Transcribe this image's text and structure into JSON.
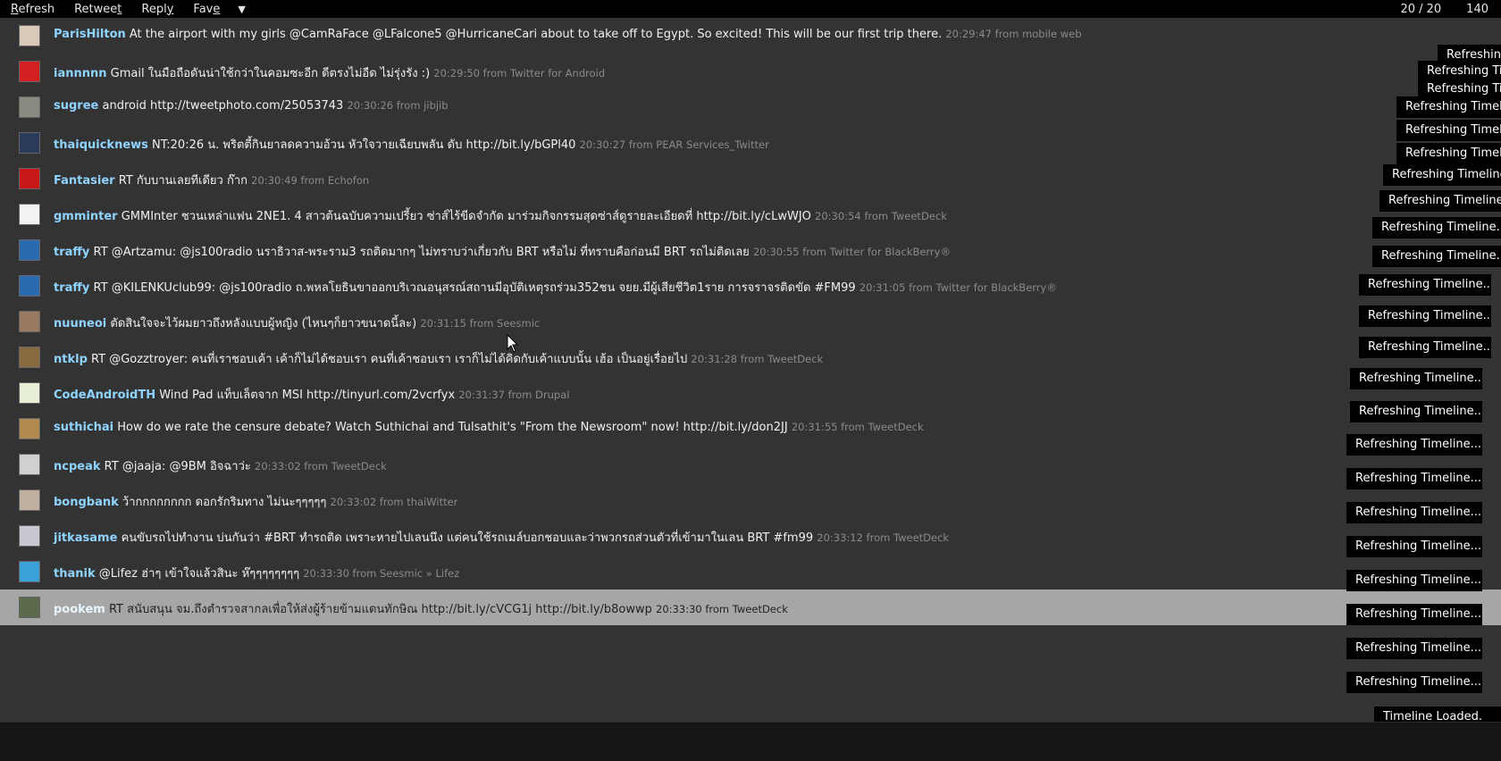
{
  "toolbar": {
    "refresh": {
      "pre": "",
      "key": "R",
      "post": "efresh"
    },
    "retweet": {
      "pre": "Retwee",
      "key": "t",
      "post": ""
    },
    "reply": {
      "pre": "Repl",
      "key": "y",
      "post": ""
    },
    "fave": {
      "pre": "Fav",
      "key": "e",
      "post": ""
    },
    "menu_arrow": "▼",
    "count": "20 / 20",
    "chars_left": "140"
  },
  "tweets": [
    {
      "user": "ParisHilton",
      "text": "At the airport with my girls @CamRaFace @LFalcone5 @HurricaneCari about to take off to Egypt. So excited! This will be our first trip there.",
      "meta": "20:29:47 from mobile web",
      "avatar_color": "#d9c9b8"
    },
    {
      "user": "iannnnn",
      "text": "Gmail ในมือถือดันน่าใช้กว่าในคอมซะอีก ดีตรงไม่อืด ไม่รุ่งรัง :)",
      "meta": "20:29:50 from Twitter for Android",
      "avatar_color": "#d42020"
    },
    {
      "user": "sugree",
      "text": "android http://tweetphoto.com/25053743",
      "meta": "20:30:26 from jibjib",
      "avatar_color": "#8a8a80"
    },
    {
      "user": "thaiquicknews",
      "text": "NT:20:26 น. พริตตี้กินยาลดความอ้วน หัวใจวายเฉียบพลัน ดับ http://bit.ly/bGPl40",
      "meta": "20:30:27 from PEAR Services_Twitter",
      "avatar_color": "#2a3a5a"
    },
    {
      "user": "Fantasier",
      "text": "RT กับบานเลยทีเดียว ก๊าก",
      "meta": "20:30:49 from Echofon",
      "avatar_color": "#c81818"
    },
    {
      "user": "gmminter",
      "text": "GMMInter ชวนเหล่าแฟน 2NE1. 4 สาวต้นฉบับความเปรี้ยว ซ่าส์ไร้ขีดจำกัด มาร่วมกิจกรรมสุดซ่าส์ดูรายละเอียดที่ http://bit.ly/cLwWJO",
      "meta": "20:30:54 from TweetDeck",
      "avatar_color": "#f2f2f2"
    },
    {
      "user": "traffy",
      "text": "RT @Artzamu: @js100radio นราธิวาส-พระราม3 รถติดมากๆ ไม่ทราบว่าเกี่ยวกับ BRT หรือไม่ ที่ทราบคือก่อนมี BRT รถไม่ติดเลย",
      "meta": "20:30:55 from Twitter for BlackBerry®",
      "avatar_color": "#2a6ab0"
    },
    {
      "user": "traffy",
      "text": "RT @KILENKUclub99: @js100radio ถ.พหลโยธินขาออกบริเวณอนุสรณ์สถานมีอุบัติเหตุรถร่วม352ชน จยย.มีผู้เสียชีวิต1ราย การจราจรติดขัด #FM99",
      "meta": "20:31:05 from Twitter for BlackBerry®",
      "avatar_color": "#2a6ab0"
    },
    {
      "user": "nuuneoi",
      "text": "ตัดสินใจจะไว้ผมยาวถึงหลังแบบผู้หญิง (ไหนๆก็ยาวขนาดนี้ละ)",
      "meta": "20:31:15 from Seesmic",
      "avatar_color": "#9a7a60"
    },
    {
      "user": "ntklp",
      "text": "RT @Gozztroyer: คนที่เราชอบเค้า เค้าก็ไม่ได้ชอบเรา คนที่เค้าชอบเรา เราก็ไม่ได้คิดกับเค้าแบบนั้น เฮ้อ เป็นอยู่เรื่อยไป",
      "meta": "20:31:28 from TweetDeck",
      "avatar_color": "#8a6a40"
    },
    {
      "user": "CodeAndroidTH",
      "text": "Wind Pad แท็บเล็ตจาก MSI http://tinyurl.com/2vcrfyx",
      "meta": "20:31:37 from Drupal",
      "avatar_color": "#e8f0d8"
    },
    {
      "user": "suthichai",
      "text": "How do we rate the censure debate? Watch Suthichai and Tulsathit's \"From the Newsroom\" now! http://bit.ly/don2JJ",
      "meta": "20:31:55 from TweetDeck",
      "avatar_color": "#b08a50"
    },
    {
      "user": "ncpeak",
      "text": "RT @jaaja: @9BM อิจฉาว่ะ",
      "meta": "20:33:02 from TweetDeck",
      "avatar_color": "#d0d0d0"
    },
    {
      "user": "bongbank",
      "text": "ว้ากกกกกกกก ดอกรักริมทาง ไม่นะๆๆๆๆๆ",
      "meta": "20:33:02 from thaiWitter",
      "avatar_color": "#c0b0a0"
    },
    {
      "user": "jitkasame",
      "text": "คนขับรถไปทำงาน บ่นกันว่า #BRT ทำรถติด เพราะหายไปเลนนึง แต่คนใช้รถเมล์บอกชอบและว่าพวกรถส่วนตัวที่เข้ามาในเลน BRT #fm99",
      "meta": "20:33:12 from TweetDeck",
      "avatar_color": "#c8c8d0"
    },
    {
      "user": "thanik",
      "text": "@Lifez ฮ่าๆ เข้าใจแล้วสินะ ห๊ๆๆๆๆๆๆๆๆ",
      "meta": "20:33:30 from Seesmic » Lifez",
      "avatar_color": "#3aa0d8"
    },
    {
      "user": "pookem",
      "text": "RT สนับสนุน จม.ถึงตำรวจสากลเพื่อให้ส่งผู้ร้ายข้ามแดนทักษิณ http://bit.ly/cVCG1j http://bit.ly/b8owwp",
      "meta": "20:33:30 from TweetDeck",
      "avatar_color": "#5a6a4a"
    }
  ],
  "selected_index": 16,
  "toasts": {
    "refreshing": "Refreshing Timeline...",
    "refreshing_short": "Refreshing Timeline",
    "refreshing_cut": "Refreshing Timelin",
    "refreshing_tiny": "Refreshing",
    "loaded": "Timeline Loaded."
  },
  "colors": {
    "username": "#8fd3ff",
    "meta": "#8a8a8a",
    "selected_row": "#a6a6a6",
    "toast_bg": "#000000"
  }
}
